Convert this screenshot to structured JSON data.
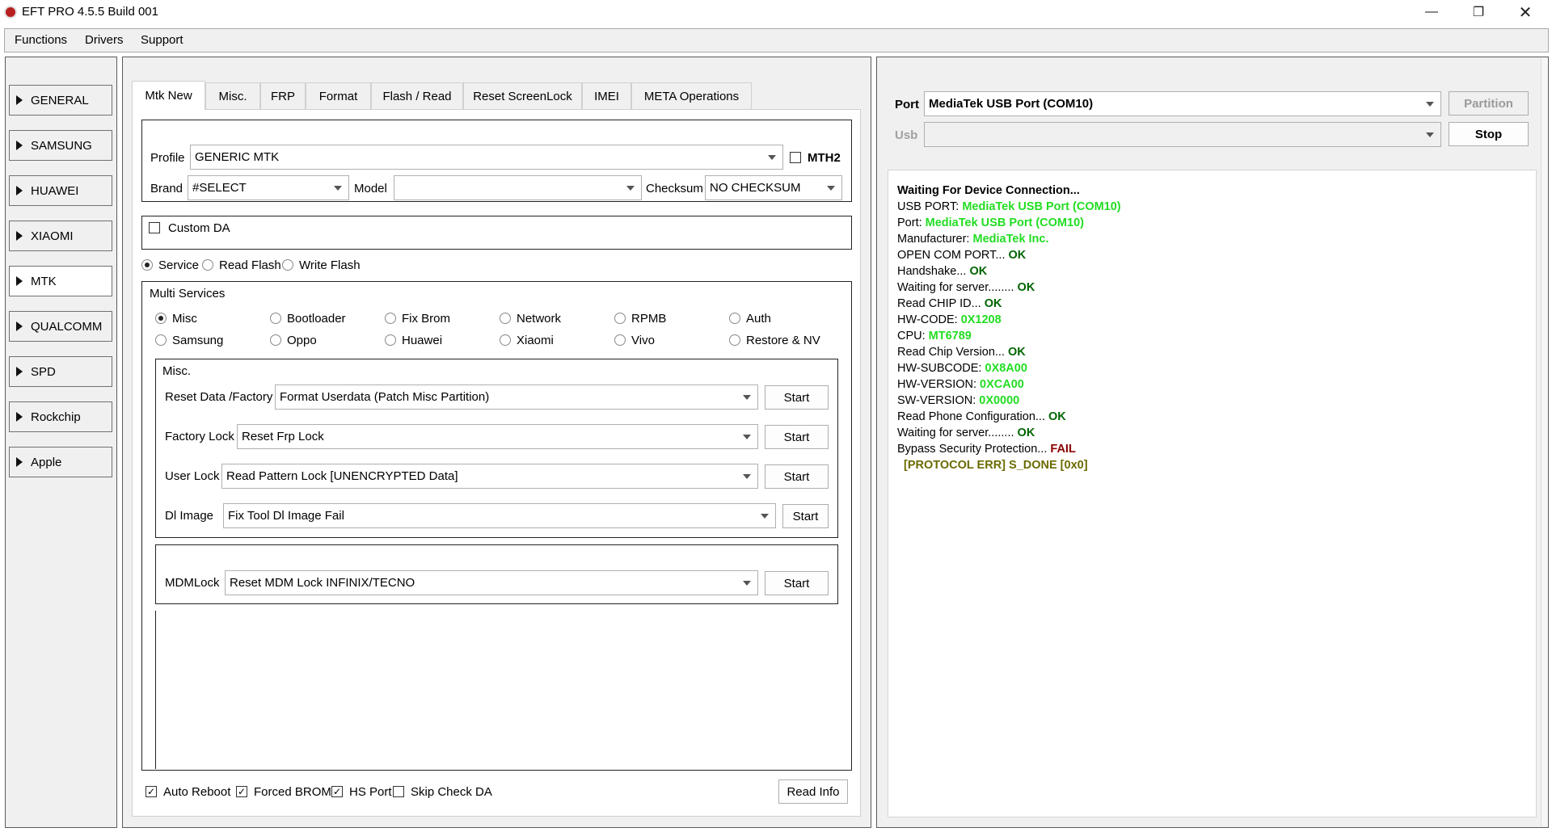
{
  "window": {
    "title": "EFT PRO 4.5.5 Build 001"
  },
  "menu": [
    "Functions",
    "Drivers",
    "Support"
  ],
  "sidebar": [
    "GENERAL",
    "SAMSUNG",
    "HUAWEI",
    "XIAOMI",
    "MTK",
    "QUALCOMM",
    "SPD",
    "Rockchip",
    "Apple"
  ],
  "tabs": [
    "Mtk New",
    "Misc.",
    "FRP",
    "Format",
    "Flash / Read",
    "Reset ScreenLock",
    "IMEI",
    "META Operations"
  ],
  "profile": {
    "label": "Profile",
    "value": "GENERIC MTK",
    "mth2_label": "MTH2"
  },
  "brand": {
    "label": "Brand",
    "value": "#SELECT"
  },
  "model": {
    "label": "Model",
    "value": ""
  },
  "checksum": {
    "label": "Checksum",
    "value": "NO CHECKSUM"
  },
  "custom_da": "Custom DA",
  "modes": [
    "Service",
    "Read Flash",
    "Write Flash"
  ],
  "multi_services": {
    "title": "Multi Services",
    "options": [
      "Misc",
      "Bootloader",
      "Fix Brom",
      "Network",
      "RPMB",
      "Auth",
      "Samsung",
      "Oppo",
      "Huawei",
      "Xiaomi",
      "Vivo",
      "Restore & NV"
    ]
  },
  "misc": {
    "title": "Misc.",
    "rows": [
      {
        "label": "Reset Data /Factory",
        "value": "Format Userdata (Patch Misc Partition)",
        "button": "Start"
      },
      {
        "label": "Factory Lock",
        "value": "Reset Frp Lock",
        "button": "Start"
      },
      {
        "label": "User Lock",
        "value": "Read Pattern Lock [UNENCRYPTED Data]",
        "button": "Start"
      },
      {
        "label": "Dl Image",
        "value": "Fix Tool Dl Image Fail",
        "button": "Start"
      }
    ]
  },
  "mdm": {
    "label": "MDMLock",
    "value": "Reset MDM Lock INFINIX/TECNO",
    "button": "Start"
  },
  "bottom": {
    "auto_reboot": "Auto Reboot",
    "forced_brom": "Forced BROM",
    "hs_port": "HS Port",
    "skip_check_da": "Skip Check DA",
    "read_info": "Read Info"
  },
  "port": {
    "label": "Port",
    "value": "MediaTek USB Port (COM10)",
    "partition": "Partition",
    "usb_label": "Usb",
    "usb_value": "",
    "stop": "Stop"
  },
  "log": [
    [
      {
        "t": "Waiting For Device Connection...",
        "c": "kb"
      }
    ],
    [
      {
        "t": "USB PORT: ",
        "c": "k"
      },
      {
        "t": "MediaTek USB Port (COM10)",
        "c": "g"
      }
    ],
    [
      {
        "t": "Port: ",
        "c": "k"
      },
      {
        "t": "MediaTek USB Port (COM10)",
        "c": "g"
      }
    ],
    [
      {
        "t": "Manufacturer: ",
        "c": "k"
      },
      {
        "t": "MediaTek Inc.",
        "c": "g"
      }
    ],
    [
      {
        "t": "OPEN COM PORT... ",
        "c": "k"
      },
      {
        "t": "OK",
        "c": "o"
      }
    ],
    [
      {
        "t": "Handshake... ",
        "c": "k"
      },
      {
        "t": "OK",
        "c": "o"
      }
    ],
    [
      {
        "t": "Waiting for server........ ",
        "c": "k"
      },
      {
        "t": "OK",
        "c": "o"
      }
    ],
    [
      {
        "t": "Read CHIP ID... ",
        "c": "k"
      },
      {
        "t": "OK",
        "c": "o"
      }
    ],
    [
      {
        "t": "HW-CODE: ",
        "c": "k"
      },
      {
        "t": "0X1208",
        "c": "g"
      }
    ],
    [
      {
        "t": "CPU: ",
        "c": "k"
      },
      {
        "t": "MT6789",
        "c": "g"
      }
    ],
    [
      {
        "t": "Read Chip Version... ",
        "c": "k"
      },
      {
        "t": "OK",
        "c": "o"
      }
    ],
    [
      {
        "t": "HW-SUBCODE: ",
        "c": "k"
      },
      {
        "t": "0X8A00",
        "c": "g"
      }
    ],
    [
      {
        "t": "HW-VERSION: ",
        "c": "k"
      },
      {
        "t": "0XCA00",
        "c": "g"
      }
    ],
    [
      {
        "t": "SW-VERSION: ",
        "c": "k"
      },
      {
        "t": "0X0000",
        "c": "g"
      }
    ],
    [
      {
        "t": "Read Phone Configuration... ",
        "c": "k"
      },
      {
        "t": "OK",
        "c": "o"
      }
    ],
    [
      {
        "t": "Waiting for server........ ",
        "c": "k"
      },
      {
        "t": "OK",
        "c": "o"
      }
    ],
    [
      {
        "t": "Bypass Security Protection... ",
        "c": "k"
      },
      {
        "t": "FAIL",
        "c": "r"
      }
    ],
    [
      {
        "t": "  [PROTOCOL ERR] S_DONE [0x0]",
        "c": "y"
      }
    ]
  ],
  "colors": {
    "ok_green": "#006400",
    "value_green": "#22dd22",
    "fail_red": "#8b0000",
    "err_olive": "#6b6b00"
  }
}
